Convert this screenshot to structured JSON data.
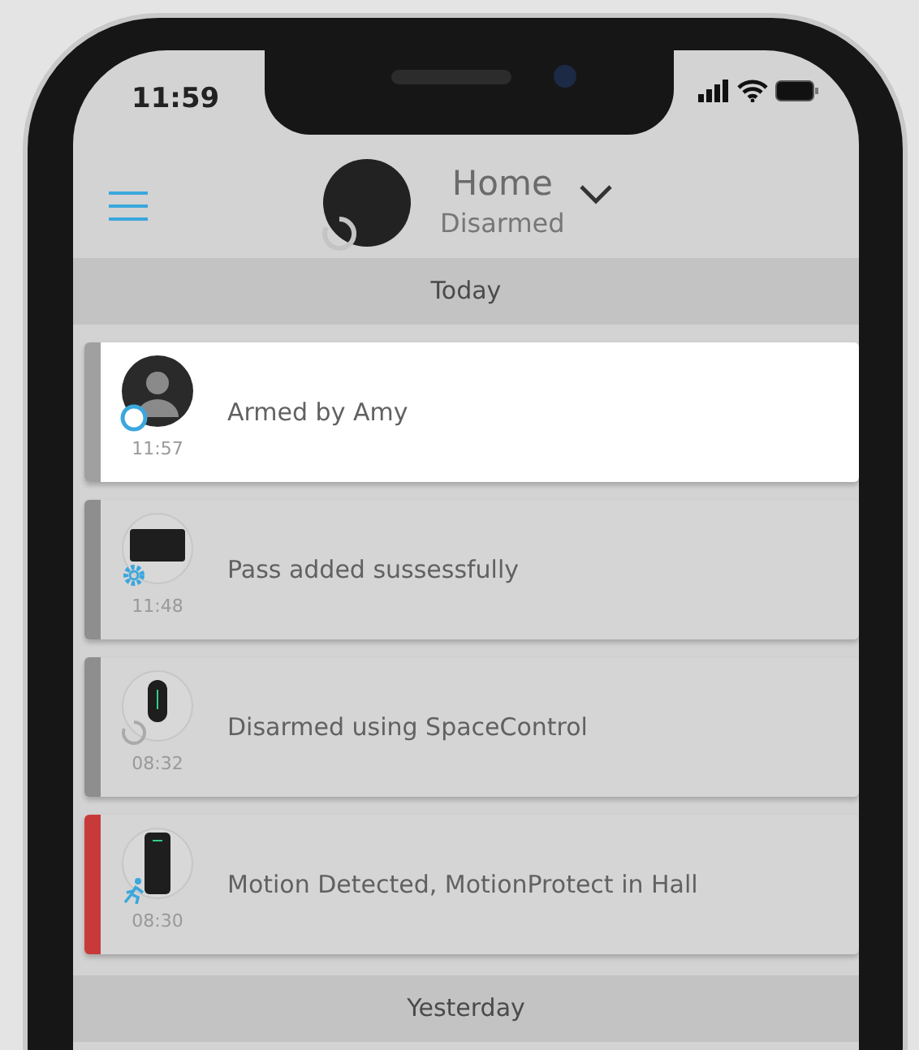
{
  "status_bar": {
    "time": "11:59"
  },
  "header": {
    "title": "Home",
    "subtitle": "Disarmed"
  },
  "sections": [
    {
      "label": "Today",
      "events": [
        {
          "kind": "armed",
          "text": "Armed by Amy",
          "time": "11:57",
          "highlighted": true,
          "color": "#a0a0a0"
        },
        {
          "kind": "pass",
          "text": "Pass added sussessfully",
          "time": "11:48",
          "highlighted": false,
          "color": "#8e8e8e"
        },
        {
          "kind": "disarmed",
          "text": "Disarmed using SpaceControl",
          "time": "08:32",
          "highlighted": false,
          "color": "#8e8e8e"
        },
        {
          "kind": "motion",
          "text": "Motion Detected, MotionProtect in Hall",
          "time": "08:30",
          "highlighted": false,
          "color": "#c83a3a"
        }
      ]
    },
    {
      "label": "Yesterday"
    }
  ]
}
